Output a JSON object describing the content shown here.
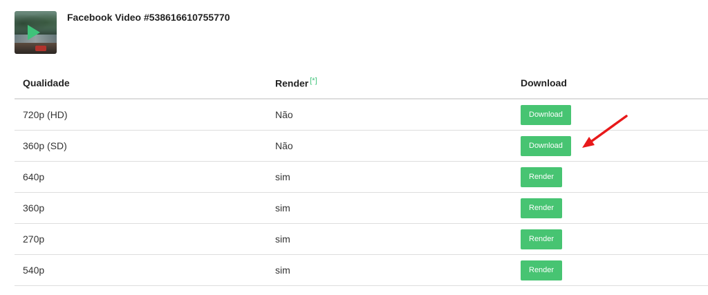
{
  "video": {
    "title": "Facebook Video #538616610755770",
    "thumbnail_icon": "play-icon"
  },
  "table": {
    "headers": {
      "quality": "Qualidade",
      "render": "Render",
      "render_note": "[*]",
      "download": "Download"
    },
    "rows": [
      {
        "quality": "720p (HD)",
        "render": "Não",
        "action": "Download"
      },
      {
        "quality": "360p (SD)",
        "render": "Não",
        "action": "Download"
      },
      {
        "quality": "640p",
        "render": "sim",
        "action": "Render"
      },
      {
        "quality": "360p",
        "render": "sim",
        "action": "Render"
      },
      {
        "quality": "270p",
        "render": "sim",
        "action": "Render"
      },
      {
        "quality": "540p",
        "render": "sim",
        "action": "Render"
      }
    ]
  },
  "colors": {
    "accent": "#47c472",
    "annotation_arrow": "#e8191a"
  }
}
